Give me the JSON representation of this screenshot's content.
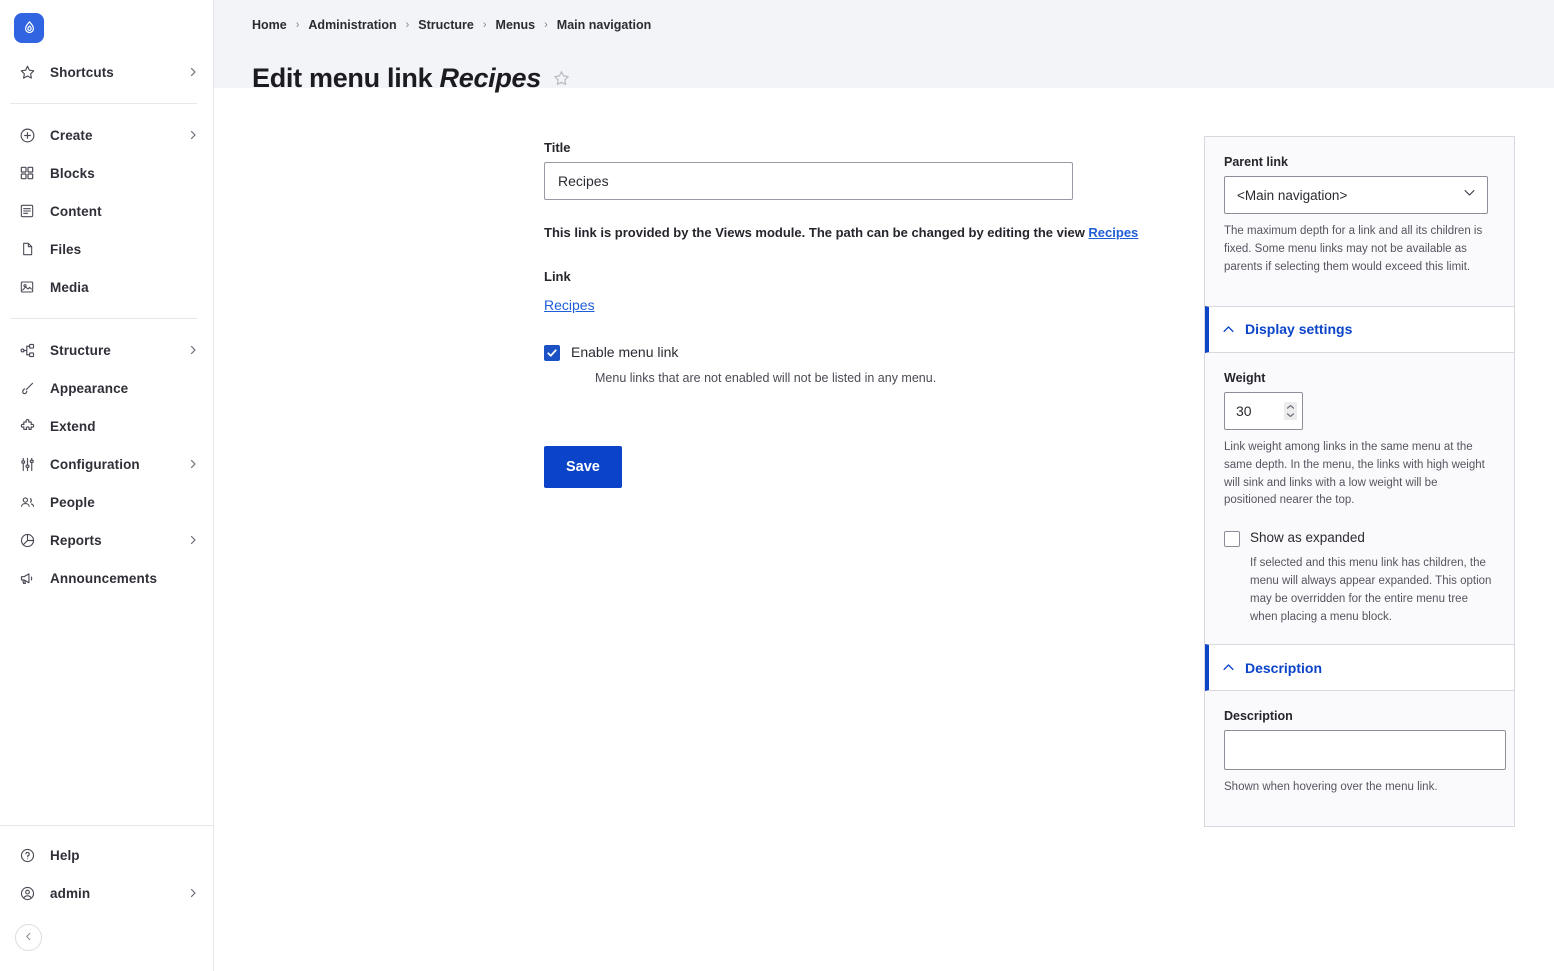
{
  "sidebar": {
    "logo_icon": "drupal-droplet-icon",
    "logo_bg": "#3164e0",
    "groups": [
      {
        "items": [
          {
            "label": "Shortcuts",
            "icon": "star-icon",
            "has_chevron": true
          }
        ]
      },
      {
        "items": [
          {
            "label": "Create",
            "icon": "plus-circle-icon",
            "has_chevron": true
          },
          {
            "label": "Blocks",
            "icon": "blocks-icon",
            "has_chevron": false
          },
          {
            "label": "Content",
            "icon": "content-icon",
            "has_chevron": false
          },
          {
            "label": "Files",
            "icon": "files-icon",
            "has_chevron": false
          },
          {
            "label": "Media",
            "icon": "media-icon",
            "has_chevron": false
          }
        ]
      },
      {
        "items": [
          {
            "label": "Structure",
            "icon": "structure-icon",
            "has_chevron": true
          },
          {
            "label": "Appearance",
            "icon": "paintbrush-icon",
            "has_chevron": false
          },
          {
            "label": "Extend",
            "icon": "puzzle-icon",
            "has_chevron": false
          },
          {
            "label": "Configuration",
            "icon": "sliders-icon",
            "has_chevron": true
          },
          {
            "label": "People",
            "icon": "people-icon",
            "has_chevron": false
          },
          {
            "label": "Reports",
            "icon": "pie-chart-icon",
            "has_chevron": true
          },
          {
            "label": "Announcements",
            "icon": "megaphone-icon",
            "has_chevron": false
          }
        ]
      }
    ],
    "bottom_items": [
      {
        "label": "Help",
        "icon": "question-circle-icon",
        "has_chevron": false
      },
      {
        "label": "admin",
        "icon": "user-circle-icon",
        "has_chevron": true
      }
    ],
    "collapse_icon": "chevron-left-icon"
  },
  "header": {
    "breadcrumb": [
      "Home",
      "Administration",
      "Structure",
      "Menus",
      "Main navigation"
    ],
    "breadcrumb_separator": "›",
    "title_prefix": "Edit menu link ",
    "title_emphasis": "Recipes",
    "star_icon": "star-outline-icon"
  },
  "form": {
    "title_label": "Title",
    "title_value": "Recipes",
    "views_note_text": "This link is provided by the Views module. The path can be changed by editing the view ",
    "views_note_link": "Recipes",
    "link_label": "Link",
    "link_value": "Recipes",
    "enable_label": "Enable menu link",
    "enable_checked": true,
    "enable_desc": "Menu links that are not enabled will not be listed in any menu.",
    "save_label": "Save"
  },
  "panel": {
    "parent_link_label": "Parent link",
    "parent_link_value": "<Main navigation>",
    "parent_link_help": "The maximum depth for a link and all its children is fixed. Some menu links may not be available as parents if selecting them would exceed this limit.",
    "display_settings_title": "Display settings",
    "display_settings_expanded": true,
    "weight_label": "Weight",
    "weight_value": "30",
    "weight_help": "Link weight among links in the same menu at the same depth. In the menu, the links with high weight will sink and links with a low weight will be positioned nearer the top.",
    "expanded_label": "Show as expanded",
    "expanded_checked": false,
    "expanded_desc": "If selected and this menu link has children, the menu will always appear expanded. This option may be overridden for the entire menu tree when placing a menu block.",
    "description_title": "Description",
    "description_expanded": true,
    "description_label": "Description",
    "description_value": "",
    "description_help": "Shown when hovering over the menu link."
  },
  "colors": {
    "accent": "#0b44c8",
    "brand_blue": "#3164e0",
    "link": "#1e5ed8",
    "header_bg": "#f3f4f7",
    "panel_bg": "#fafafc"
  }
}
